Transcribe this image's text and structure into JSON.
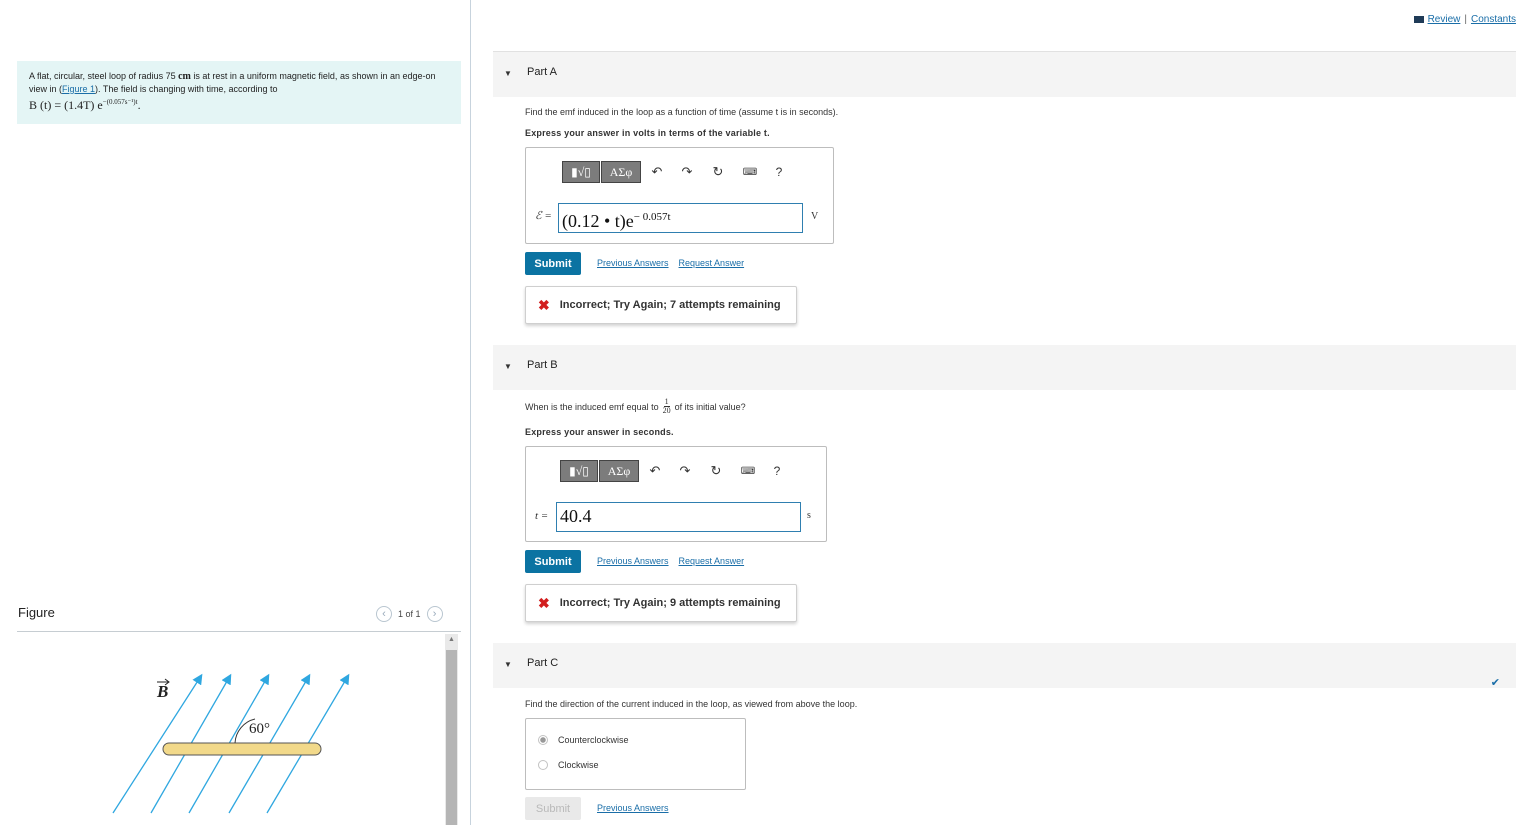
{
  "problem": {
    "intro": "A flat, circular, steel loop of radius 75 ",
    "radius_unit": "cm",
    "mid": " is at rest in a uniform magnetic field, as shown in an edge-on view in (",
    "figure_link": "Figure 1",
    "after_link": "). The field is changing with time, according to",
    "formula_lhs": "B (t) = (1.4T) e",
    "formula_exp": "−(0.057s⁻¹)t",
    "formula_end": "."
  },
  "figure": {
    "title": "Figure",
    "pager": "1 of 1",
    "field_label": "B",
    "angle_label": "60°"
  },
  "topbar": {
    "review": "Review",
    "separator": "|",
    "constants": "Constants"
  },
  "partA": {
    "title": "Part A",
    "question": "Find the emf induced in the loop as a function of time (assume t is in seconds).",
    "instruction": "Express your answer in volts in terms of the variable t.",
    "toolbar_greek": "ΑΣφ",
    "help": "?",
    "var_label": "ℰ =",
    "answer_base": "(0.12 • t)e",
    "answer_exp": "− 0.057t",
    "unit": "V",
    "submit": "Submit",
    "previous_answers": "Previous Answers",
    "request_answer": "Request Answer",
    "feedback": "Incorrect; Try Again; 7 attempts remaining"
  },
  "partB": {
    "title": "Part B",
    "question_pre": "When is the induced emf equal to",
    "frac_num": "1",
    "frac_den": "20",
    "question_post": "of its initial value?",
    "instruction": "Express your answer in seconds.",
    "toolbar_greek": "ΑΣφ",
    "help": "?",
    "var_label": "t =",
    "answer": "40.4",
    "unit": "s",
    "submit": "Submit",
    "previous_answers": "Previous Answers",
    "request_answer": "Request Answer",
    "feedback": "Incorrect; Try Again; 9 attempts remaining"
  },
  "partC": {
    "title": "Part C",
    "question": "Find the direction of the current induced in the loop, as viewed from above the loop.",
    "options": [
      "Counterclockwise",
      "Clockwise"
    ],
    "selected": "Counterclockwise",
    "submit": "Submit",
    "previous_answers": "Previous Answers"
  },
  "colors": {
    "accent": "#0b73a2",
    "link": "#1a6ea8",
    "error": "#d21e1e",
    "field_lines": "#2fa7e0",
    "loop_fill": "#f2d98a"
  }
}
